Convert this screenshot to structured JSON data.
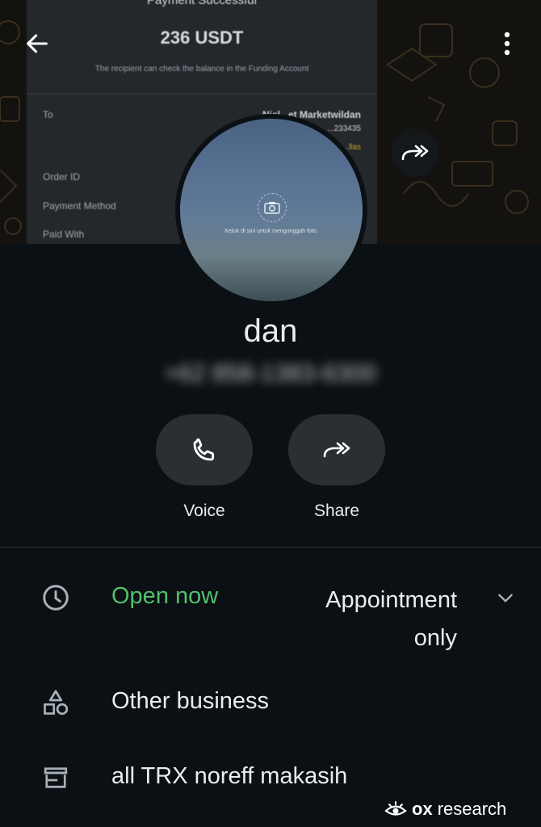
{
  "header": {
    "receipt_preview": {
      "title": "Payment Successful",
      "amount": "236 USDT",
      "subtitle": "The recipient can check the balance in the Funding Account",
      "rows": [
        {
          "label": "To",
          "value": "Nicl...et Marketwildan",
          "value2": "...233435",
          "value3": "...llas"
        },
        {
          "label": "Order ID",
          "value": ""
        },
        {
          "label": "Payment Method",
          "value": ""
        },
        {
          "label": "Paid With",
          "value": ""
        }
      ]
    }
  },
  "avatar": {
    "caption": "Ketuk di sini untuk mengunggah foto."
  },
  "contact": {
    "name": "dan",
    "phone": "+62 858-1383-6300"
  },
  "actions": [
    {
      "label": "Voice",
      "icon": "phone-icon"
    },
    {
      "label": "Share",
      "icon": "forward-icon"
    }
  ],
  "business": {
    "hours_status": "Open now",
    "hours_detail": "Appointment only",
    "category": "Other business",
    "description": "all TRX noreff makasih"
  },
  "watermark": {
    "brand": "ox",
    "rest": "research"
  },
  "colors": {
    "background": "#0b1014",
    "open_green": "#52c06a",
    "button_bg": "#2a2f33"
  }
}
